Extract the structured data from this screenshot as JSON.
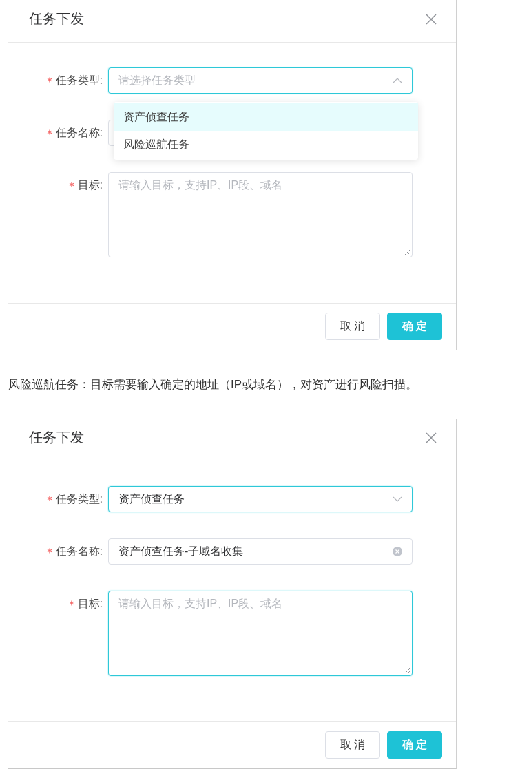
{
  "sections": [
    {
      "kind": "dialog",
      "title": "任务下发",
      "fields": [
        {
          "kind": "select",
          "label": "任务类型:",
          "required": true,
          "placeholder": "请选择任务类型",
          "focused": true,
          "expanded": true,
          "options": [
            {
              "label": "资产侦查任务",
              "highlighted": true
            },
            {
              "label": "风险巡航任务",
              "highlighted": false
            }
          ]
        },
        {
          "kind": "input",
          "label": "任务名称:",
          "required": true,
          "focused": false
        },
        {
          "kind": "textarea",
          "label": "目标:",
          "required": true,
          "placeholder": "请输入目标，支持IP、IP段、域名",
          "focused": false
        }
      ],
      "buttons": [
        {
          "label": "取 消",
          "kind": "default"
        },
        {
          "label": "确 定",
          "kind": "primary"
        }
      ]
    },
    {
      "kind": "paragraph",
      "text": "风险巡航任务：目标需要输入确定的地址（IP或域名），对资产进行风险扫描。"
    },
    {
      "kind": "dialog",
      "title": "任务下发",
      "fields": [
        {
          "kind": "select",
          "label": "任务类型:",
          "required": true,
          "value": "资产侦查任务",
          "focused": true,
          "expanded": false
        },
        {
          "kind": "input",
          "label": "任务名称:",
          "required": true,
          "value": "资产侦查任务-子域名收集",
          "focused": false,
          "clearable": true
        },
        {
          "kind": "textarea",
          "label": "目标:",
          "required": true,
          "placeholder": "请输入目标，支持IP、IP段、域名",
          "focused": true
        }
      ],
      "buttons": [
        {
          "label": "取 消",
          "kind": "default"
        },
        {
          "label": "确 定",
          "kind": "primary"
        }
      ]
    }
  ]
}
